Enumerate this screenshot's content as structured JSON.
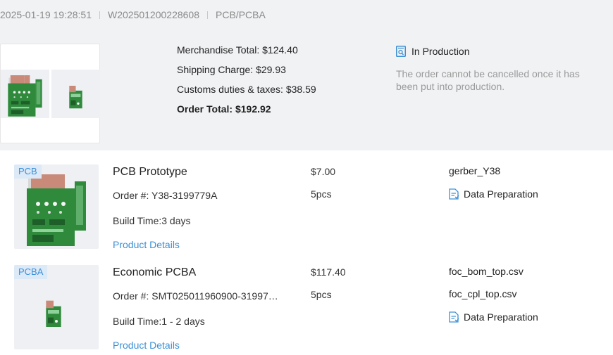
{
  "order": {
    "datetime": "2025-01-19 19:28:51",
    "order_no": "W202501200228608",
    "category": "PCB/PCBA",
    "totals": {
      "merchandise": "Merchandise Total: $124.40",
      "shipping": "Shipping Charge: $29.93",
      "customs": "Customs duties & taxes: $38.59",
      "order_total": "Order Total: $192.92"
    },
    "status": {
      "label": "In Production",
      "note": "The order cannot be cancelled once it has been put into production.",
      "icon": "search-document-icon"
    }
  },
  "items": [
    {
      "tag": "PCB",
      "name": "PCB Prototype",
      "order_number": "Order #: Y38-3199779A",
      "build_time": "Build Time:3 days",
      "details_link": "Product Details",
      "price": "$7.00",
      "quantity": "5pcs",
      "files": [
        "gerber_Y38"
      ],
      "status": "Data Preparation"
    },
    {
      "tag": "PCBA",
      "name": "Economic PCBA",
      "order_number": "Order #: SMT025011960900-31997…",
      "build_time": "Build Time:1 - 2 days",
      "details_link": "Product Details",
      "price": "$117.40",
      "quantity": "5pcs",
      "files": [
        "foc_bom_top.csv",
        "foc_cpl_top.csv"
      ],
      "status": "Data Preparation"
    }
  ],
  "colors": {
    "header_bg": "#f1f2f4",
    "link": "#3a90d6",
    "tag_bg": "#dceaf8",
    "tag_text": "#3d8fd8",
    "board_green": "#2e8b3e"
  }
}
